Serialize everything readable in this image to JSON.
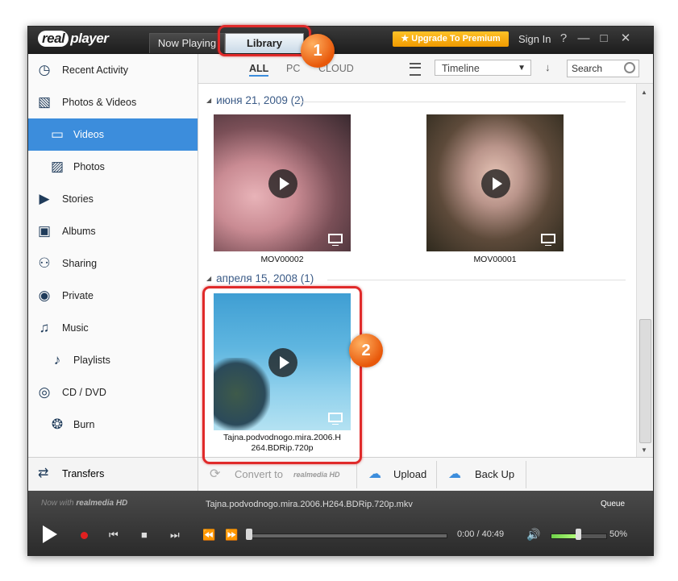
{
  "app": {
    "logo_text": "realplayer",
    "tabs": {
      "now_playing": "Now Playing",
      "library": "Library"
    },
    "upgrade": "★ Upgrade To Premium",
    "sign_in": "Sign In",
    "window_buttons": {
      "help": "?",
      "minimize": "—",
      "maximize": "□",
      "close": "✕"
    }
  },
  "sidebar": {
    "items": [
      {
        "label": "Recent Activity",
        "icon": "clock-icon"
      },
      {
        "label": "Photos & Videos",
        "icon": "photos-icon"
      },
      {
        "label": "Videos",
        "icon": "film-icon"
      },
      {
        "label": "Photos",
        "icon": "photo-icon"
      },
      {
        "label": "Stories",
        "icon": "stories-icon"
      },
      {
        "label": "Albums",
        "icon": "albums-icon"
      },
      {
        "label": "Sharing",
        "icon": "people-icon"
      },
      {
        "label": "Private",
        "icon": "eye-icon"
      },
      {
        "label": "Music",
        "icon": "music-note-icon"
      },
      {
        "label": "Playlists",
        "icon": "playlist-icon"
      },
      {
        "label": "CD / DVD",
        "icon": "disc-icon"
      },
      {
        "label": "Burn",
        "icon": "burn-icon"
      }
    ],
    "transfers": "Transfers"
  },
  "filter": {
    "tabs": [
      "ALL",
      "PC",
      "CLOUD"
    ],
    "sort_selected": "Timeline",
    "search_placeholder": "Search"
  },
  "groups": [
    {
      "title": "июня 21, 2009 (2)",
      "items": [
        {
          "caption": "MOV00002"
        },
        {
          "caption": "MOV00001"
        }
      ]
    },
    {
      "title": "апреля 15, 2008 (1)",
      "items": [
        {
          "caption_line1": "Tajna.podvodnogo.mira.2006.H",
          "caption_line2": "264.BDRip.720p"
        }
      ]
    }
  ],
  "callouts": {
    "one": "1",
    "two": "2"
  },
  "actions": {
    "convert": "Convert to",
    "convert_brand": "realmedia HD",
    "upload": "Upload",
    "backup": "Back Up"
  },
  "player": {
    "now_with": "Now with",
    "now_with_brand": "realmedia HD",
    "filename": "Tajna.podvodnogo.mira.2006.H264.BDRip.720p.mkv",
    "queue": "Queue",
    "time": "0:00 / 40:49",
    "progress": 0,
    "volume_label": "50%",
    "volume": 0.5
  },
  "colors": {
    "accent": "#3c8ddc",
    "callout": "#e02a2a",
    "badge": "#e8580a",
    "upgrade": "#f5a800"
  }
}
